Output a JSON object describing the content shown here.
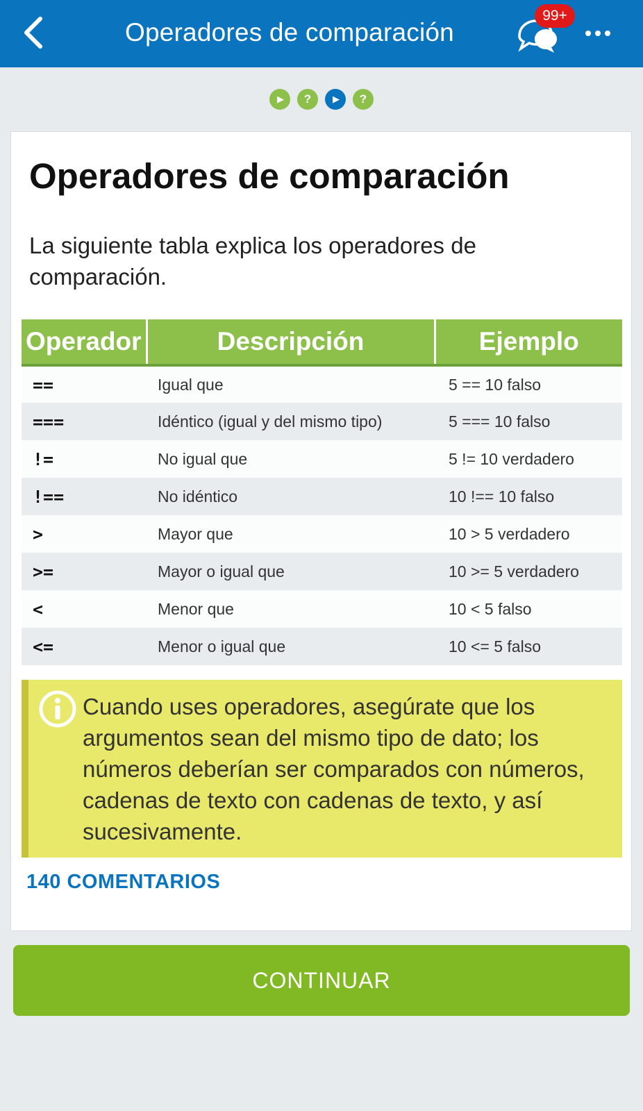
{
  "header": {
    "title": "Operadores de comparación",
    "badge": "99+",
    "colors": {
      "bar": "#0a74be",
      "badge": "#e11919"
    }
  },
  "progress": {
    "steps": [
      {
        "icon": "play-icon",
        "glyph": "▶",
        "state": "done"
      },
      {
        "icon": "question-icon",
        "glyph": "?",
        "state": "done"
      },
      {
        "icon": "play-icon",
        "glyph": "▶",
        "state": "current"
      },
      {
        "icon": "question-icon",
        "glyph": "?",
        "state": "pending"
      }
    ]
  },
  "lesson": {
    "title": "Operadores de comparación",
    "intro": "La siguiente tabla explica los operadores de comparación.",
    "table": {
      "headers": [
        "Operador",
        "Descripción",
        "Ejemplo"
      ],
      "rows": [
        [
          "==",
          "Igual que",
          "5 == 10  falso"
        ],
        [
          "===",
          "Idéntico (igual y del mismo tipo)",
          "5 === 10 falso"
        ],
        [
          "!=",
          "No igual que",
          "5 != 10 verdadero"
        ],
        [
          "!==",
          "No idéntico",
          "10 !== 10 falso"
        ],
        [
          ">",
          "Mayor que",
          "10 > 5 verdadero"
        ],
        [
          ">=",
          "Mayor o igual que",
          "10 >= 5 verdadero"
        ],
        [
          "<",
          "Menor que",
          "10 < 5 falso"
        ],
        [
          "<=",
          "Menor o igual que",
          "10 <= 5 falso"
        ]
      ]
    },
    "note": "Cuando uses operadores, asegúrate que los argumentos sean del mismo tipo de dato; los números deberían ser comparados con números, cadenas de texto con cadenas de texto, y así sucesivamente.",
    "comments_label": "140 COMENTARIOS"
  },
  "footer": {
    "continue_label": "CONTINUAR",
    "accent": "#80b924"
  }
}
